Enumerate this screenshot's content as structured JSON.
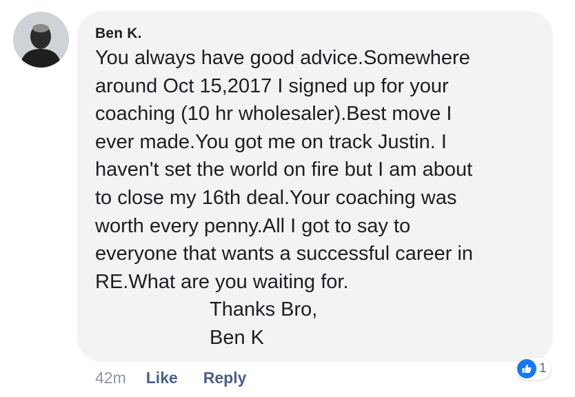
{
  "comment": {
    "author": "Ben K.",
    "lines": [
      "You always have good advice.Somewhere",
      "around Oct 15,2017 I signed up for your",
      "coaching (10 hr wholesaler).Best move I",
      "ever made.You got me on track Justin. I",
      "haven't set the world on fire but I am about",
      "to close my 16th deal.Your coaching was",
      "worth every penny.All I got to say to",
      "everyone that wants a successful career in",
      "RE.What are you waiting for."
    ],
    "signoff": [
      "Thanks Bro,",
      "Ben K"
    ],
    "timestamp": "42m",
    "like_label": "Like",
    "reply_label": "Reply",
    "reaction": {
      "icon": "thumbs-up-icon",
      "count": "1",
      "color": "#1877f2"
    }
  },
  "colors": {
    "bubble": "#f2f3f5",
    "text": "#1c1e21",
    "link": "#4c5f86",
    "muted": "#8d949e"
  }
}
